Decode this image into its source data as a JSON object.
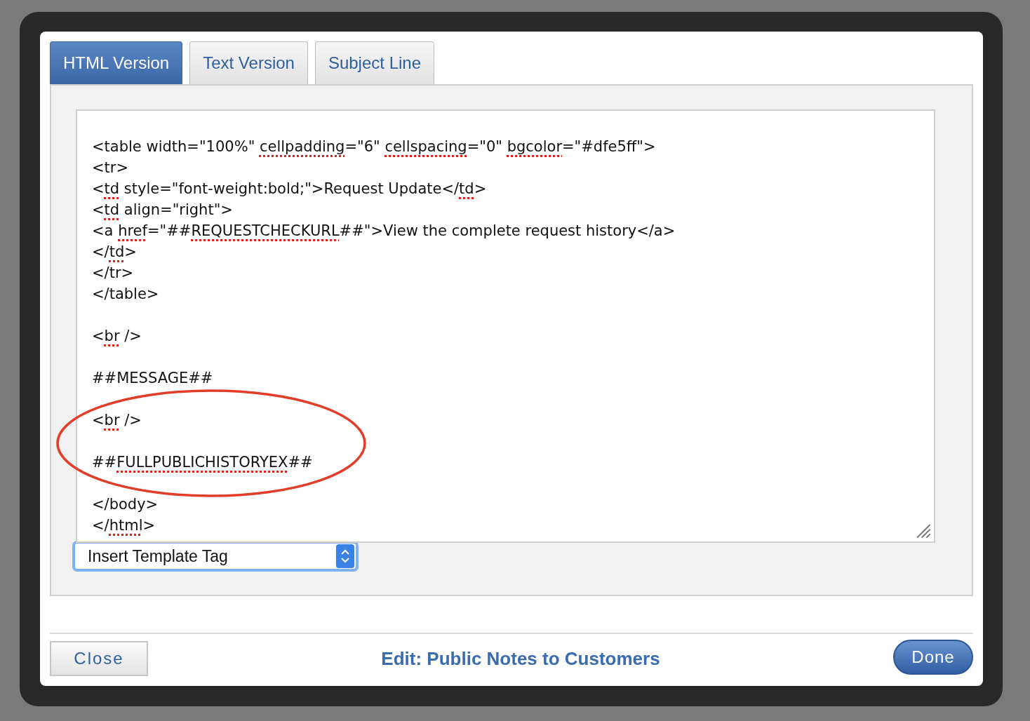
{
  "tabs": [
    {
      "label": "HTML Version",
      "selected": true
    },
    {
      "label": "Text Version",
      "selected": false
    },
    {
      "label": "Subject Line",
      "selected": false
    }
  ],
  "editor": {
    "lines": [
      {
        "kind": "code",
        "segments": [
          {
            "text": "<table width=\"100%\" "
          },
          {
            "text": "cellpadding",
            "misspelled": true
          },
          {
            "text": "=\"6\" "
          },
          {
            "text": "cellspacing",
            "misspelled": true
          },
          {
            "text": "=\"0\" "
          },
          {
            "text": "bgcolor",
            "misspelled": true
          },
          {
            "text": "=\"#dfe5ff\">"
          }
        ]
      },
      {
        "kind": "code",
        "segments": [
          {
            "text": "<tr>"
          }
        ]
      },
      {
        "kind": "code",
        "segments": [
          {
            "text": "<"
          },
          {
            "text": "td",
            "misspelled": true
          },
          {
            "text": " style=\"font-weight:bold;\">Request Update</"
          },
          {
            "text": "td",
            "misspelled": true
          },
          {
            "text": ">"
          }
        ]
      },
      {
        "kind": "code",
        "segments": [
          {
            "text": "<"
          },
          {
            "text": "td",
            "misspelled": true
          },
          {
            "text": " align=\"right\">"
          }
        ]
      },
      {
        "kind": "code",
        "segments": [
          {
            "text": "<a "
          },
          {
            "text": "href",
            "misspelled": true
          },
          {
            "text": "=\"##"
          },
          {
            "text": "REQUESTCHECKURL",
            "misspelled": true
          },
          {
            "text": "##\">View the complete request history</a>"
          }
        ]
      },
      {
        "kind": "code",
        "segments": [
          {
            "text": "</"
          },
          {
            "text": "td",
            "misspelled": true
          },
          {
            "text": ">"
          }
        ]
      },
      {
        "kind": "code",
        "segments": [
          {
            "text": "</tr>"
          }
        ]
      },
      {
        "kind": "code",
        "segments": [
          {
            "text": "</table>"
          }
        ]
      },
      {
        "kind": "blank"
      },
      {
        "kind": "code",
        "segments": [
          {
            "text": "<"
          },
          {
            "text": "br",
            "misspelled": true
          },
          {
            "text": " />"
          }
        ]
      },
      {
        "kind": "blank"
      },
      {
        "kind": "code",
        "segments": [
          {
            "text": "##MESSAGE##"
          }
        ]
      },
      {
        "kind": "blank"
      },
      {
        "kind": "code",
        "segments": [
          {
            "text": "<"
          },
          {
            "text": "br",
            "misspelled": true
          },
          {
            "text": " />"
          }
        ]
      },
      {
        "kind": "blank"
      },
      {
        "kind": "code",
        "segments": [
          {
            "text": "##"
          },
          {
            "text": "FULLPUBLICHISTORYEX",
            "misspelled": true
          },
          {
            "text": "##"
          }
        ]
      },
      {
        "kind": "blank"
      },
      {
        "kind": "code",
        "segments": [
          {
            "text": "</body>"
          }
        ]
      },
      {
        "kind": "code",
        "segments": [
          {
            "text": "</"
          },
          {
            "text": "html",
            "misspelled": true
          },
          {
            "text": ">"
          }
        ]
      }
    ]
  },
  "annotation": {
    "kind": "ellipse"
  },
  "template_select": {
    "value": "Insert Template Tag"
  },
  "footer": {
    "close_button": "Close",
    "title": "Edit: Public Notes to Customers",
    "done_button": "Done"
  }
}
